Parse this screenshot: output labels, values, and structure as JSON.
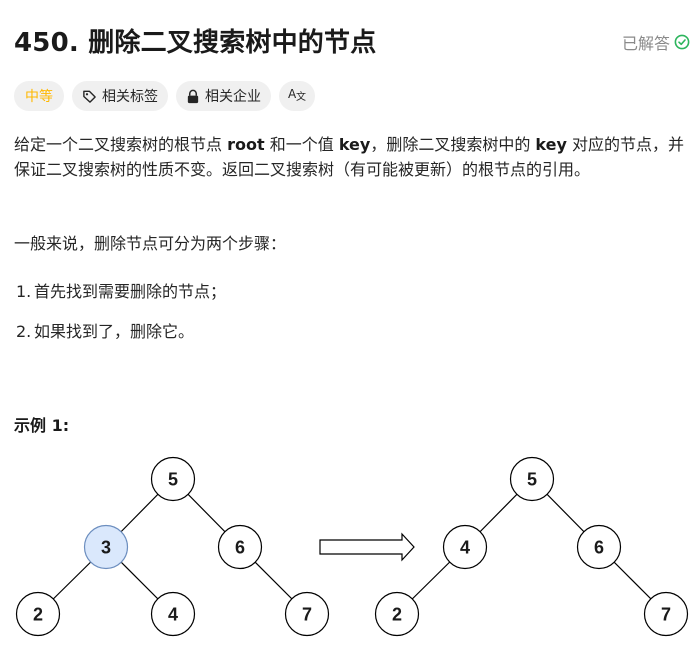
{
  "problem": {
    "title": "450. 删除二叉搜索树中的节点",
    "status": "已解答"
  },
  "tags": {
    "difficulty": "中等",
    "topics": "相关标签",
    "companies": "相关企业"
  },
  "description": {
    "p1_a": "给定一个二叉搜索树的根节点 ",
    "p1_root": "root",
    "p1_b": " 和一个值 ",
    "p1_key1": "key",
    "p1_c": "，删除二叉搜索树中的 ",
    "p1_key2": "key",
    "p1_d": " 对应的节点，并保证二叉搜索树的性质不变。返回二叉搜索树（有可能被更新）的根节点的引用。",
    "p2": "一般来说，删除节点可分为两个步骤：",
    "steps": [
      {
        "num": "1.",
        "text": "首先找到需要删除的节点；"
      },
      {
        "num": "2.",
        "text": "如果找到了，删除它。"
      }
    ]
  },
  "example": {
    "title": "示例 1:",
    "before": {
      "nodes": [
        {
          "label": "5"
        },
        {
          "label": "3",
          "highlight": true
        },
        {
          "label": "6"
        },
        {
          "label": "2"
        },
        {
          "label": "4"
        },
        {
          "label": "7"
        }
      ]
    },
    "after": {
      "nodes": [
        {
          "label": "5"
        },
        {
          "label": "4"
        },
        {
          "label": "6"
        },
        {
          "label": "2"
        },
        {
          "label": "7"
        }
      ]
    },
    "highlight_color": "#dae8fc",
    "highlight_stroke": "#6c8ebf"
  },
  "colors": {
    "difficulty": "#ffb800",
    "solved_check": "#2db55d"
  }
}
